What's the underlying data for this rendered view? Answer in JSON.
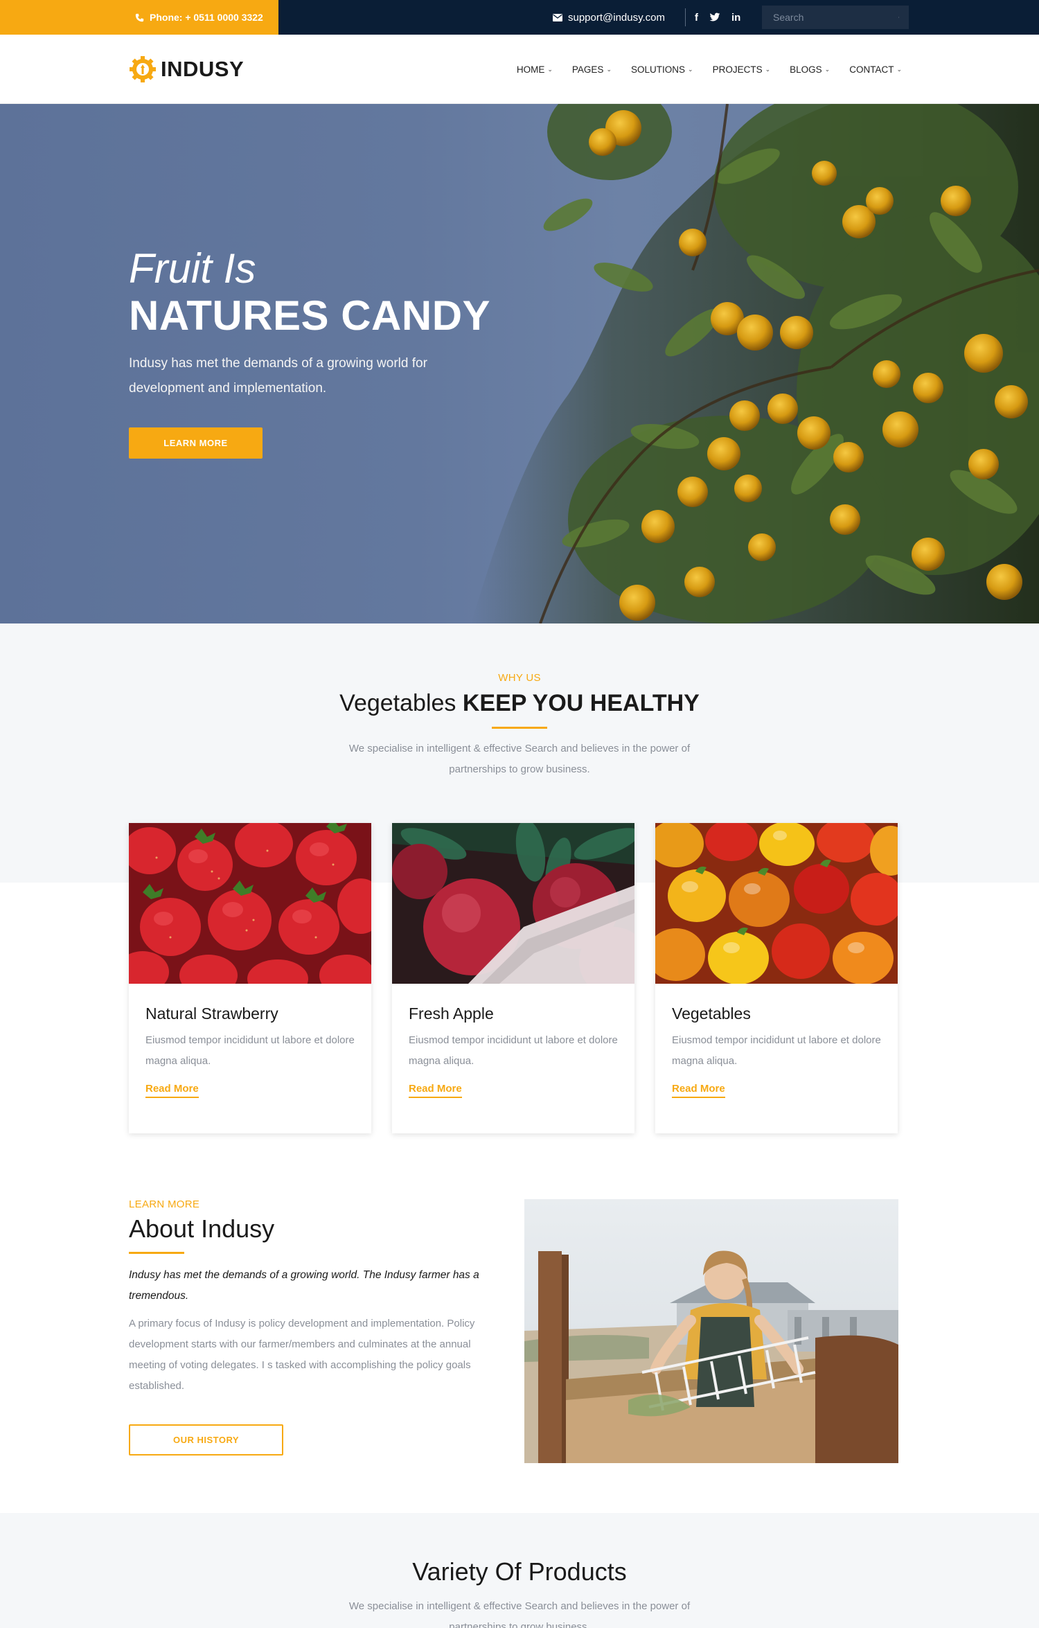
{
  "colors": {
    "accent": "#f7a912",
    "topbar": "#0a1e36",
    "text": "#1a1a1a",
    "muted": "#8a8f98",
    "section_bg": "#f5f7f9"
  },
  "topbar": {
    "phone": "Phone: + 0511 0000 3322",
    "email": "support@indusy.com",
    "social": [
      "facebook-icon",
      "twitter-icon",
      "linkedin-icon"
    ],
    "search_placeholder": "Search"
  },
  "header": {
    "logo": "INDUSY",
    "nav": [
      {
        "label": "HOME"
      },
      {
        "label": "PAGES"
      },
      {
        "label": "SOLUTIONS"
      },
      {
        "label": "PROJECTS"
      },
      {
        "label": "BLOGS"
      },
      {
        "label": "CONTACT"
      }
    ]
  },
  "hero": {
    "kicker": "Fruit Is",
    "title": "NATURES CANDY",
    "lead": "Indusy has met the demands of a growing world for development and implementation.",
    "button": "LEARN MORE"
  },
  "why": {
    "eyebrow": "WHY US",
    "title_regular": "Vegetables",
    "title_bold": "KEEP YOU HEALTHY",
    "description": "We specialise in intelligent & effective Search and believes in the power of partnerships to grow business."
  },
  "cards": [
    {
      "title": "Natural Strawberry",
      "text": "Eiusmod tempor incididunt ut labore et dolore magna aliqua.",
      "link": "Read More"
    },
    {
      "title": "Fresh Apple",
      "text": "Eiusmod tempor incididunt ut labore et dolore magna aliqua.",
      "link": "Read More"
    },
    {
      "title": "Vegetables",
      "text": "Eiusmod tempor incididunt ut labore et dolore magna aliqua.",
      "link": "Read More"
    }
  ],
  "about": {
    "eyebrow": "LEARN MORE",
    "title": "About Indusy",
    "intro": "Indusy has met the demands of a growing world. The Indusy farmer has a tremendous.",
    "description": "A primary focus of Indusy is policy development and implementation. Policy development starts with our farmer/members and culminates at the annual meeting of voting delegates. I s tasked with accomplishing the policy goals established.",
    "button": "OUR HISTORY"
  },
  "variety": {
    "title": "Variety Of Products",
    "description": "We specialise in intelligent & effective Search and believes in the power of partnerships to grow business."
  }
}
